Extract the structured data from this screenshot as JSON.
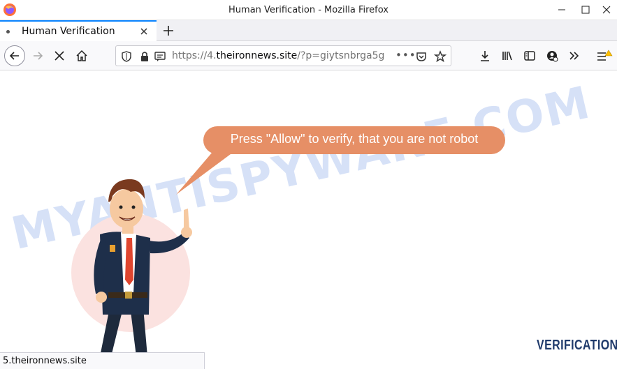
{
  "window": {
    "title": "Human Verification - Mozilla Firefox"
  },
  "tabs": [
    {
      "label": "Human Verification",
      "active": true
    }
  ],
  "urlbar": {
    "prefix": "https://4.",
    "domain": "theironnews.site",
    "path": "/?p=giytsnbrga5g",
    "more": "•••"
  },
  "page": {
    "bubble_text": "Press \"Allow\" to verify, that you are not robot",
    "watermark": "MYANTISPYWARE.COM",
    "logo_text": "VERIFICATION"
  },
  "status": {
    "text": "5.theironnews.site"
  },
  "colors": {
    "accent": "#0a84ff",
    "bubble": "#e68f66",
    "logo": "#1f3a6b"
  },
  "icons": [
    "firefox-logo",
    "minimize-icon",
    "maximize-icon",
    "close-icon",
    "tab-close-icon",
    "plus-icon",
    "back-icon",
    "forward-icon",
    "stop-icon",
    "home-icon",
    "shield-icon",
    "lock-icon",
    "notification-icon",
    "pocket-icon",
    "bookmark-star-icon",
    "download-icon",
    "library-icon",
    "sidebar-icon",
    "account-icon",
    "overflow-icon",
    "menu-icon"
  ]
}
